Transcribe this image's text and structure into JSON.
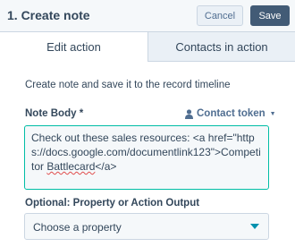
{
  "header": {
    "title": "1. Create note",
    "cancel_label": "Cancel",
    "save_label": "Save"
  },
  "tabs": [
    {
      "label": "Edit action",
      "active": true
    },
    {
      "label": "Contacts in action",
      "active": false
    }
  ],
  "description": "Create note and save it to the record timeline",
  "note_body": {
    "label": "Note Body *",
    "token_label": "Contact token",
    "value_before": "Check out these sales resources: <a href=\"https://docs.google.com/documentlink123\">Competitor ",
    "value_misspelled": "Battlecard",
    "value_after": "</a>"
  },
  "property": {
    "label": "Optional: Property or Action Output",
    "placeholder": "Choose a property"
  },
  "colors": {
    "accent_border": "#00bda5",
    "primary_button": "#425b76",
    "link": "#506e91",
    "caret": "#0091ae"
  }
}
